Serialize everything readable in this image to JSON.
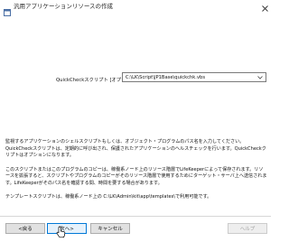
{
  "window": {
    "title": "汎用アプリケーションリソースの作成"
  },
  "form": {
    "label": "QuickCheckスクリプト [オプション]:",
    "value": "C:\\LK\\Script\\JP1Base\\quickchk.vbs"
  },
  "description": {
    "paragraphs": [
      "監視するアプリケーションのシェルスクリプトもしくは、オブジェクト・プログラムのパス名を入力してください。QuickCheckスクリプトは、定期的に呼び出され、保護されたアプリケーションのヘルスチェックを行います。QuickCheckクリプトはオプションになります。",
      "このスクリプトまたはこのプログラムのコピーは、稼働系ノード上のリソース階層でLifeKeeperによって保存されます。リソースを拡張すると、スクリプトやプログラムのコピーがそのリソース階層で使用するためにターゲット・サーバ上へ送信されます。LifeKeeperがそのパス名を確認する間、時間を要する場合があります。",
      "テンプレートスクリプトは、稼働系ノード上の C:\\LK\\Admin\\kit\\app\\templates\\で利用可能です。"
    ]
  },
  "buttons": {
    "back": "<戻る",
    "next": "次へ>",
    "cancel": "キャンセル",
    "help": "ヘルプ"
  },
  "icons": {
    "app": "app-window-icon",
    "close": "close-icon",
    "dropdown": "chevron-down-icon",
    "cursor": "mouse-pointer-icon"
  }
}
